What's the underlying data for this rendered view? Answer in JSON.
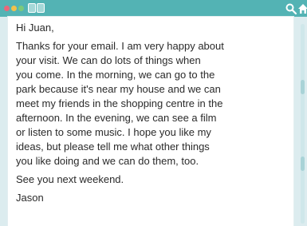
{
  "email": {
    "greeting": "Hi Juan,",
    "body_lines": [
      "Thanks for your email. I am very happy about",
      "your visit. We can do lots of things when",
      "you come. In the morning, we can go to the",
      "park because it's near my house and we can",
      "meet my friends in the shopping centre in the",
      "afternoon. In the evening, we can see a film",
      "or listen to some music. I hope you like my",
      "ideas, but please tell me what other things",
      "you like doing and we can do them, too."
    ],
    "closing": "See you next weekend.",
    "signature": "Jason"
  },
  "colors": {
    "titlebar": "#53b3b4",
    "background": "#dcecef",
    "paper": "#ffffff",
    "text": "#2a2a2a"
  },
  "icons": {
    "search": "search-icon",
    "home": "home-icon"
  }
}
